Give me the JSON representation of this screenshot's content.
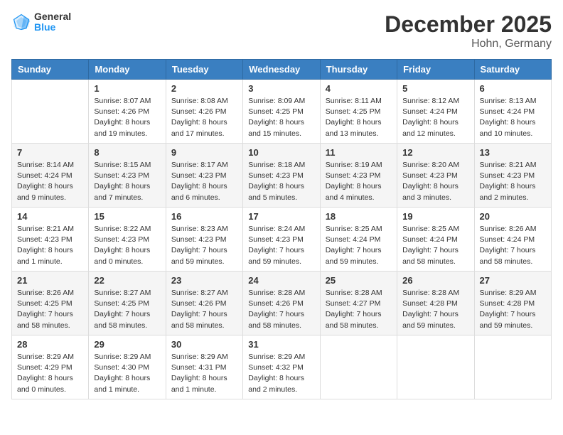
{
  "header": {
    "logo_general": "General",
    "logo_blue": "Blue",
    "month_title": "December 2025",
    "location": "Hohn, Germany"
  },
  "weekdays": [
    "Sunday",
    "Monday",
    "Tuesday",
    "Wednesday",
    "Thursday",
    "Friday",
    "Saturday"
  ],
  "weeks": [
    [
      {
        "day": "",
        "info": ""
      },
      {
        "day": "1",
        "info": "Sunrise: 8:07 AM\nSunset: 4:26 PM\nDaylight: 8 hours\nand 19 minutes."
      },
      {
        "day": "2",
        "info": "Sunrise: 8:08 AM\nSunset: 4:26 PM\nDaylight: 8 hours\nand 17 minutes."
      },
      {
        "day": "3",
        "info": "Sunrise: 8:09 AM\nSunset: 4:25 PM\nDaylight: 8 hours\nand 15 minutes."
      },
      {
        "day": "4",
        "info": "Sunrise: 8:11 AM\nSunset: 4:25 PM\nDaylight: 8 hours\nand 13 minutes."
      },
      {
        "day": "5",
        "info": "Sunrise: 8:12 AM\nSunset: 4:24 PM\nDaylight: 8 hours\nand 12 minutes."
      },
      {
        "day": "6",
        "info": "Sunrise: 8:13 AM\nSunset: 4:24 PM\nDaylight: 8 hours\nand 10 minutes."
      }
    ],
    [
      {
        "day": "7",
        "info": "Sunrise: 8:14 AM\nSunset: 4:24 PM\nDaylight: 8 hours\nand 9 minutes."
      },
      {
        "day": "8",
        "info": "Sunrise: 8:15 AM\nSunset: 4:23 PM\nDaylight: 8 hours\nand 7 minutes."
      },
      {
        "day": "9",
        "info": "Sunrise: 8:17 AM\nSunset: 4:23 PM\nDaylight: 8 hours\nand 6 minutes."
      },
      {
        "day": "10",
        "info": "Sunrise: 8:18 AM\nSunset: 4:23 PM\nDaylight: 8 hours\nand 5 minutes."
      },
      {
        "day": "11",
        "info": "Sunrise: 8:19 AM\nSunset: 4:23 PM\nDaylight: 8 hours\nand 4 minutes."
      },
      {
        "day": "12",
        "info": "Sunrise: 8:20 AM\nSunset: 4:23 PM\nDaylight: 8 hours\nand 3 minutes."
      },
      {
        "day": "13",
        "info": "Sunrise: 8:21 AM\nSunset: 4:23 PM\nDaylight: 8 hours\nand 2 minutes."
      }
    ],
    [
      {
        "day": "14",
        "info": "Sunrise: 8:21 AM\nSunset: 4:23 PM\nDaylight: 8 hours\nand 1 minute."
      },
      {
        "day": "15",
        "info": "Sunrise: 8:22 AM\nSunset: 4:23 PM\nDaylight: 8 hours\nand 0 minutes."
      },
      {
        "day": "16",
        "info": "Sunrise: 8:23 AM\nSunset: 4:23 PM\nDaylight: 7 hours\nand 59 minutes."
      },
      {
        "day": "17",
        "info": "Sunrise: 8:24 AM\nSunset: 4:23 PM\nDaylight: 7 hours\nand 59 minutes."
      },
      {
        "day": "18",
        "info": "Sunrise: 8:25 AM\nSunset: 4:24 PM\nDaylight: 7 hours\nand 59 minutes."
      },
      {
        "day": "19",
        "info": "Sunrise: 8:25 AM\nSunset: 4:24 PM\nDaylight: 7 hours\nand 58 minutes."
      },
      {
        "day": "20",
        "info": "Sunrise: 8:26 AM\nSunset: 4:24 PM\nDaylight: 7 hours\nand 58 minutes."
      }
    ],
    [
      {
        "day": "21",
        "info": "Sunrise: 8:26 AM\nSunset: 4:25 PM\nDaylight: 7 hours\nand 58 minutes."
      },
      {
        "day": "22",
        "info": "Sunrise: 8:27 AM\nSunset: 4:25 PM\nDaylight: 7 hours\nand 58 minutes."
      },
      {
        "day": "23",
        "info": "Sunrise: 8:27 AM\nSunset: 4:26 PM\nDaylight: 7 hours\nand 58 minutes."
      },
      {
        "day": "24",
        "info": "Sunrise: 8:28 AM\nSunset: 4:26 PM\nDaylight: 7 hours\nand 58 minutes."
      },
      {
        "day": "25",
        "info": "Sunrise: 8:28 AM\nSunset: 4:27 PM\nDaylight: 7 hours\nand 58 minutes."
      },
      {
        "day": "26",
        "info": "Sunrise: 8:28 AM\nSunset: 4:28 PM\nDaylight: 7 hours\nand 59 minutes."
      },
      {
        "day": "27",
        "info": "Sunrise: 8:29 AM\nSunset: 4:28 PM\nDaylight: 7 hours\nand 59 minutes."
      }
    ],
    [
      {
        "day": "28",
        "info": "Sunrise: 8:29 AM\nSunset: 4:29 PM\nDaylight: 8 hours\nand 0 minutes."
      },
      {
        "day": "29",
        "info": "Sunrise: 8:29 AM\nSunset: 4:30 PM\nDaylight: 8 hours\nand 1 minute."
      },
      {
        "day": "30",
        "info": "Sunrise: 8:29 AM\nSunset: 4:31 PM\nDaylight: 8 hours\nand 1 minute."
      },
      {
        "day": "31",
        "info": "Sunrise: 8:29 AM\nSunset: 4:32 PM\nDaylight: 8 hours\nand 2 minutes."
      },
      {
        "day": "",
        "info": ""
      },
      {
        "day": "",
        "info": ""
      },
      {
        "day": "",
        "info": ""
      }
    ]
  ]
}
